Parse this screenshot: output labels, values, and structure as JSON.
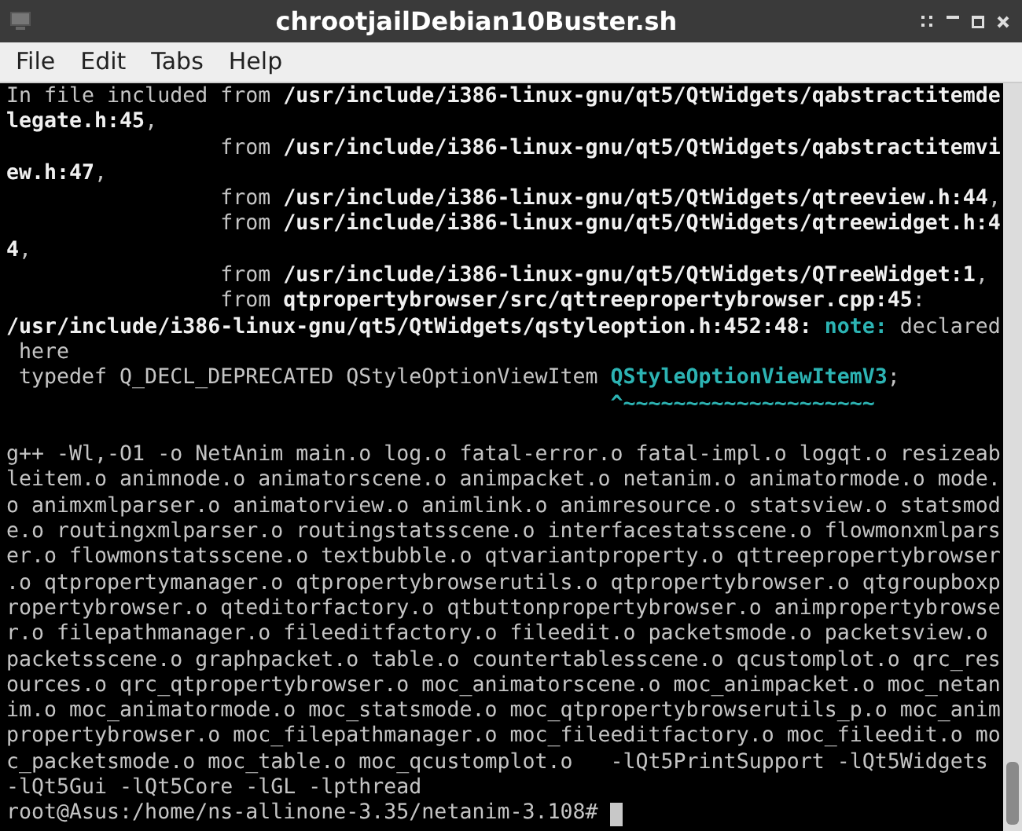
{
  "window": {
    "title": "chrootjailDebian10Buster.sh"
  },
  "menu": [
    "File",
    "Edit",
    "Tabs",
    "Help"
  ],
  "terminal": {
    "cursor_visible": true,
    "lines": [
      [
        {
          "kind": "normal",
          "text": "In file included from "
        },
        {
          "kind": "bold",
          "text": "/usr/include/i386-linux-gnu/qt5/QtWidgets/qabstractitemde"
        }
      ],
      [
        {
          "kind": "bold",
          "text": "legate.h:45"
        },
        {
          "kind": "normal",
          "text": ","
        }
      ],
      [
        {
          "kind": "normal",
          "text": "                 from "
        },
        {
          "kind": "bold",
          "text": "/usr/include/i386-linux-gnu/qt5/QtWidgets/qabstractitemvi"
        }
      ],
      [
        {
          "kind": "bold",
          "text": "ew.h:47"
        },
        {
          "kind": "normal",
          "text": ","
        }
      ],
      [
        {
          "kind": "normal",
          "text": "                 from "
        },
        {
          "kind": "bold",
          "text": "/usr/include/i386-linux-gnu/qt5/QtWidgets/qtreeview.h:44"
        },
        {
          "kind": "normal",
          "text": ","
        }
      ],
      [
        {
          "kind": "normal",
          "text": "                 from "
        },
        {
          "kind": "bold",
          "text": "/usr/include/i386-linux-gnu/qt5/QtWidgets/qtreewidget.h:4"
        }
      ],
      [
        {
          "kind": "bold",
          "text": "4"
        },
        {
          "kind": "normal",
          "text": ","
        }
      ],
      [
        {
          "kind": "normal",
          "text": "                 from "
        },
        {
          "kind": "bold",
          "text": "/usr/include/i386-linux-gnu/qt5/QtWidgets/QTreeWidget:1"
        },
        {
          "kind": "normal",
          "text": ","
        }
      ],
      [
        {
          "kind": "normal",
          "text": "                 from "
        },
        {
          "kind": "bold",
          "text": "qtpropertybrowser/src/qttreepropertybrowser.cpp:45"
        },
        {
          "kind": "normal",
          "text": ":"
        }
      ],
      [
        {
          "kind": "bold",
          "text": "/usr/include/i386-linux-gnu/qt5/QtWidgets/qstyleoption.h:452:48: "
        },
        {
          "kind": "note",
          "text": "note:"
        },
        {
          "kind": "normal",
          "text": " declared"
        }
      ],
      [
        {
          "kind": "normal",
          "text": " here"
        }
      ],
      [
        {
          "kind": "normal",
          "text": " typedef Q_DECL_DEPRECATED QStyleOptionViewItem "
        },
        {
          "kind": "note",
          "text": "QStyleOptionViewItemV3"
        },
        {
          "kind": "normal",
          "text": ";"
        }
      ],
      [
        {
          "kind": "note",
          "text": "                                                ^~~~~~~~~~~~~~~~~~~~~"
        }
      ],
      [
        {
          "kind": "normal",
          "gap_before": true,
          "text": "g++ -Wl,-O1 -o NetAnim main.o log.o fatal-error.o fatal-impl.o logqt.o resizeab"
        }
      ],
      [
        {
          "kind": "normal",
          "text": "leitem.o animnode.o animatorscene.o animpacket.o netanim.o animatormode.o mode."
        }
      ],
      [
        {
          "kind": "normal",
          "text": "o animxmlparser.o animatorview.o animlink.o animresource.o statsview.o statsmod"
        }
      ],
      [
        {
          "kind": "normal",
          "text": "e.o routingxmlparser.o routingstatsscene.o interfacestatsscene.o flowmonxmlpars"
        }
      ],
      [
        {
          "kind": "normal",
          "text": "er.o flowmonstatsscene.o textbubble.o qtvariantproperty.o qttreepropertybrowser"
        }
      ],
      [
        {
          "kind": "normal",
          "text": ".o qtpropertymanager.o qtpropertybrowserutils.o qtpropertybrowser.o qtgroupboxp"
        }
      ],
      [
        {
          "kind": "normal",
          "text": "ropertybrowser.o qteditorfactory.o qtbuttonpropertybrowser.o animpropertybrowse"
        }
      ],
      [
        {
          "kind": "normal",
          "text": "r.o filepathmanager.o fileeditfactory.o fileedit.o packetsmode.o packetsview.o"
        }
      ],
      [
        {
          "kind": "normal",
          "text": "packetsscene.o graphpacket.o table.o countertablesscene.o qcustomplot.o qrc_res"
        }
      ],
      [
        {
          "kind": "normal",
          "text": "ources.o qrc_qtpropertybrowser.o moc_animatorscene.o moc_animpacket.o moc_netan"
        }
      ],
      [
        {
          "kind": "normal",
          "text": "im.o moc_animatormode.o moc_statsmode.o moc_qtpropertybrowserutils_p.o moc_anim"
        }
      ],
      [
        {
          "kind": "normal",
          "text": "propertybrowser.o moc_filepathmanager.o moc_fileeditfactory.o moc_fileedit.o mo"
        }
      ],
      [
        {
          "kind": "normal",
          "text": "c_packetsmode.o moc_table.o moc_qcustomplot.o   -lQt5PrintSupport -lQt5Widgets"
        }
      ],
      [
        {
          "kind": "normal",
          "text": "-lQt5Gui -lQt5Core -lGL -lpthread"
        }
      ],
      [
        {
          "kind": "normal",
          "text": "root@Asus:/home/ns-allinone-3.35/netanim-3.108# "
        }
      ]
    ]
  }
}
